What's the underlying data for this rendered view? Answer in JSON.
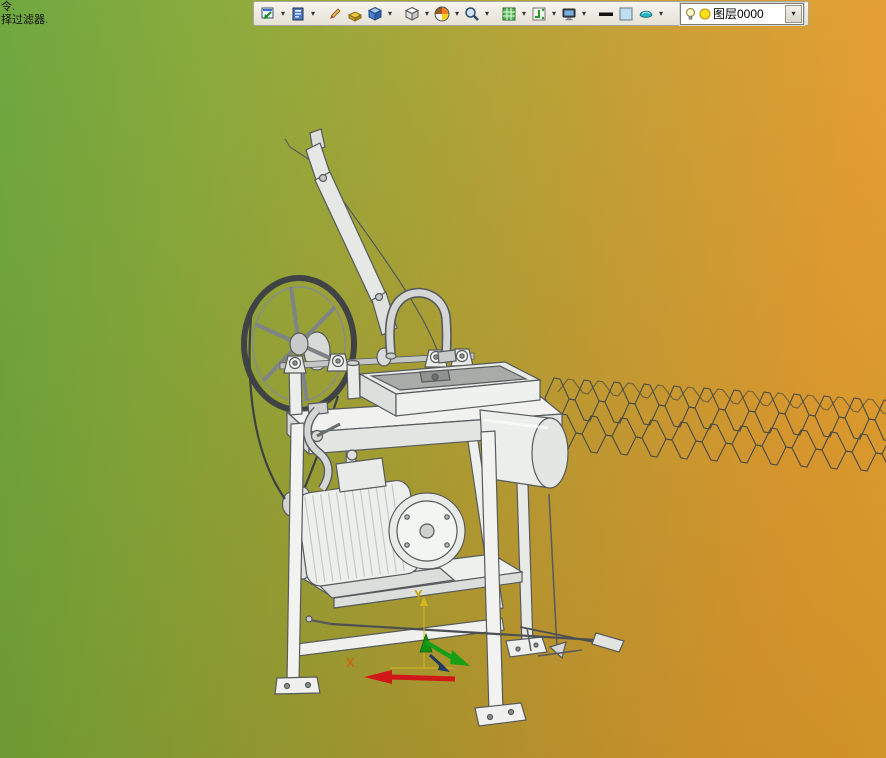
{
  "prompt": {
    "line1": "令.",
    "line2": "择过滤器."
  },
  "toolbar": {
    "chevron": "▾",
    "icons": [
      {
        "name": "window-arrow-icon",
        "has_dropdown": true
      },
      {
        "name": "blue-document-icon",
        "has_dropdown": true
      },
      {
        "name": "pencil-icon",
        "has_dropdown": false
      },
      {
        "name": "yellow-part-icon",
        "has_dropdown": false
      },
      {
        "name": "blue-cube-icon",
        "has_dropdown": true
      },
      {
        "name": "white-cube-icon",
        "has_dropdown": true
      },
      {
        "name": "color-wheel-icon",
        "has_dropdown": true
      },
      {
        "name": "magnifier-icon",
        "has_dropdown": true
      },
      {
        "name": "green-grid-icon",
        "has_dropdown": true
      },
      {
        "name": "snap-grid-icon",
        "has_dropdown": true
      },
      {
        "name": "monitor-icon",
        "has_dropdown": true
      },
      {
        "name": "line-width-icon",
        "has_dropdown": false
      },
      {
        "name": "color-swatch-icon",
        "has_dropdown": false
      },
      {
        "name": "teal-surface-icon",
        "has_dropdown": true
      }
    ],
    "layer_selector": {
      "value": "图层0000",
      "dropdown": "▾"
    }
  },
  "viewport": {
    "triad": {
      "x_label": "X",
      "y_label": "Y"
    },
    "colors": {
      "background_left": "#63a43c",
      "background_right": "#e8a02c",
      "axis_x": "#d01818",
      "axis_y": "#c8a400",
      "axis_z": "#17a017"
    }
  }
}
